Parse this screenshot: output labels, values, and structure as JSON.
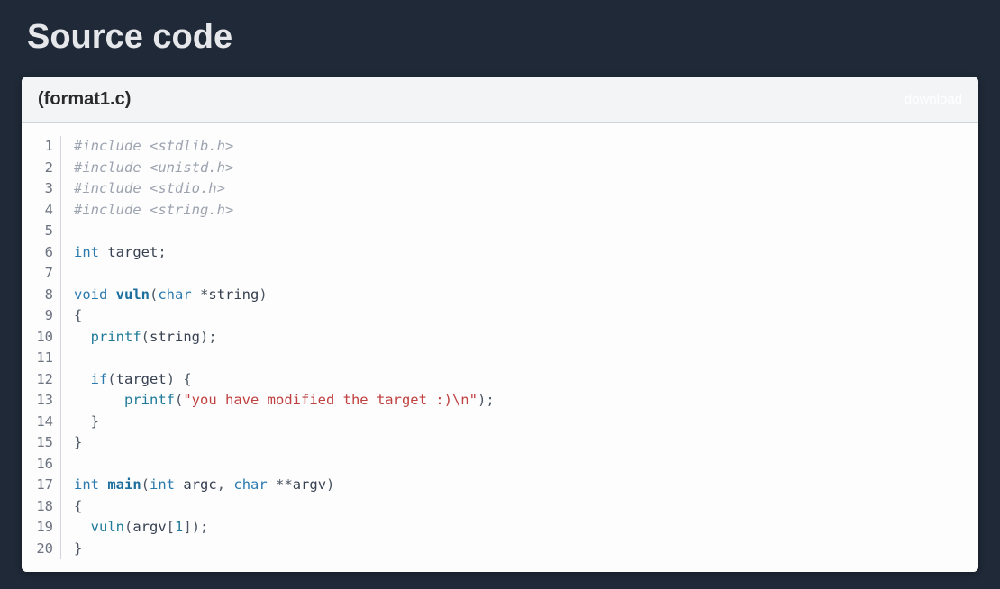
{
  "title": "Source code",
  "filename": "(format1.c)",
  "download_label": "download",
  "lines": [
    {
      "n": 1,
      "tokens": [
        [
          "comment",
          "#include <stdlib.h>"
        ]
      ]
    },
    {
      "n": 2,
      "tokens": [
        [
          "comment",
          "#include <unistd.h>"
        ]
      ]
    },
    {
      "n": 3,
      "tokens": [
        [
          "comment",
          "#include <stdio.h>"
        ]
      ]
    },
    {
      "n": 4,
      "tokens": [
        [
          "comment",
          "#include <string.h>"
        ]
      ]
    },
    {
      "n": 5,
      "tokens": []
    },
    {
      "n": 6,
      "tokens": [
        [
          "keyword",
          "int"
        ],
        [
          "plain",
          " "
        ],
        [
          "ident",
          "target"
        ],
        [
          "punct",
          ";"
        ]
      ]
    },
    {
      "n": 7,
      "tokens": []
    },
    {
      "n": 8,
      "tokens": [
        [
          "keyword",
          "void"
        ],
        [
          "plain",
          " "
        ],
        [
          "fn",
          "vuln"
        ],
        [
          "paren",
          "("
        ],
        [
          "keyword",
          "char"
        ],
        [
          "plain",
          " "
        ],
        [
          "punct",
          "*"
        ],
        [
          "ident",
          "string"
        ],
        [
          "paren",
          ")"
        ]
      ]
    },
    {
      "n": 9,
      "tokens": [
        [
          "punct",
          "{"
        ]
      ]
    },
    {
      "n": 10,
      "tokens": [
        [
          "plain",
          "  "
        ],
        [
          "call",
          "printf"
        ],
        [
          "paren",
          "("
        ],
        [
          "ident",
          "string"
        ],
        [
          "paren",
          ")"
        ],
        [
          "punct",
          ";"
        ]
      ]
    },
    {
      "n": 11,
      "tokens": []
    },
    {
      "n": 12,
      "tokens": [
        [
          "plain",
          "  "
        ],
        [
          "keyword",
          "if"
        ],
        [
          "paren",
          "("
        ],
        [
          "ident",
          "target"
        ],
        [
          "paren",
          ")"
        ],
        [
          "plain",
          " "
        ],
        [
          "punct",
          "{"
        ]
      ]
    },
    {
      "n": 13,
      "tokens": [
        [
          "plain",
          "      "
        ],
        [
          "call",
          "printf"
        ],
        [
          "paren",
          "("
        ],
        [
          "string",
          "\"you have modified the target :)"
        ],
        [
          "esc",
          "\\n"
        ],
        [
          "string",
          "\""
        ],
        [
          "paren",
          ")"
        ],
        [
          "punct",
          ";"
        ]
      ]
    },
    {
      "n": 14,
      "tokens": [
        [
          "plain",
          "  "
        ],
        [
          "punct",
          "}"
        ]
      ]
    },
    {
      "n": 15,
      "tokens": [
        [
          "punct",
          "}"
        ]
      ]
    },
    {
      "n": 16,
      "tokens": []
    },
    {
      "n": 17,
      "tokens": [
        [
          "keyword",
          "int"
        ],
        [
          "plain",
          " "
        ],
        [
          "fn",
          "main"
        ],
        [
          "paren",
          "("
        ],
        [
          "keyword",
          "int"
        ],
        [
          "plain",
          " "
        ],
        [
          "ident",
          "argc"
        ],
        [
          "punct",
          ","
        ],
        [
          "plain",
          " "
        ],
        [
          "keyword",
          "char"
        ],
        [
          "plain",
          " "
        ],
        [
          "punct",
          "**"
        ],
        [
          "ident",
          "argv"
        ],
        [
          "paren",
          ")"
        ]
      ]
    },
    {
      "n": 18,
      "tokens": [
        [
          "punct",
          "{"
        ]
      ]
    },
    {
      "n": 19,
      "tokens": [
        [
          "plain",
          "  "
        ],
        [
          "call",
          "vuln"
        ],
        [
          "paren",
          "("
        ],
        [
          "ident",
          "argv"
        ],
        [
          "punct",
          "["
        ],
        [
          "num",
          "1"
        ],
        [
          "punct",
          "]"
        ],
        [
          "paren",
          ")"
        ],
        [
          "punct",
          ";"
        ]
      ]
    },
    {
      "n": 20,
      "tokens": [
        [
          "punct",
          "}"
        ]
      ]
    }
  ]
}
